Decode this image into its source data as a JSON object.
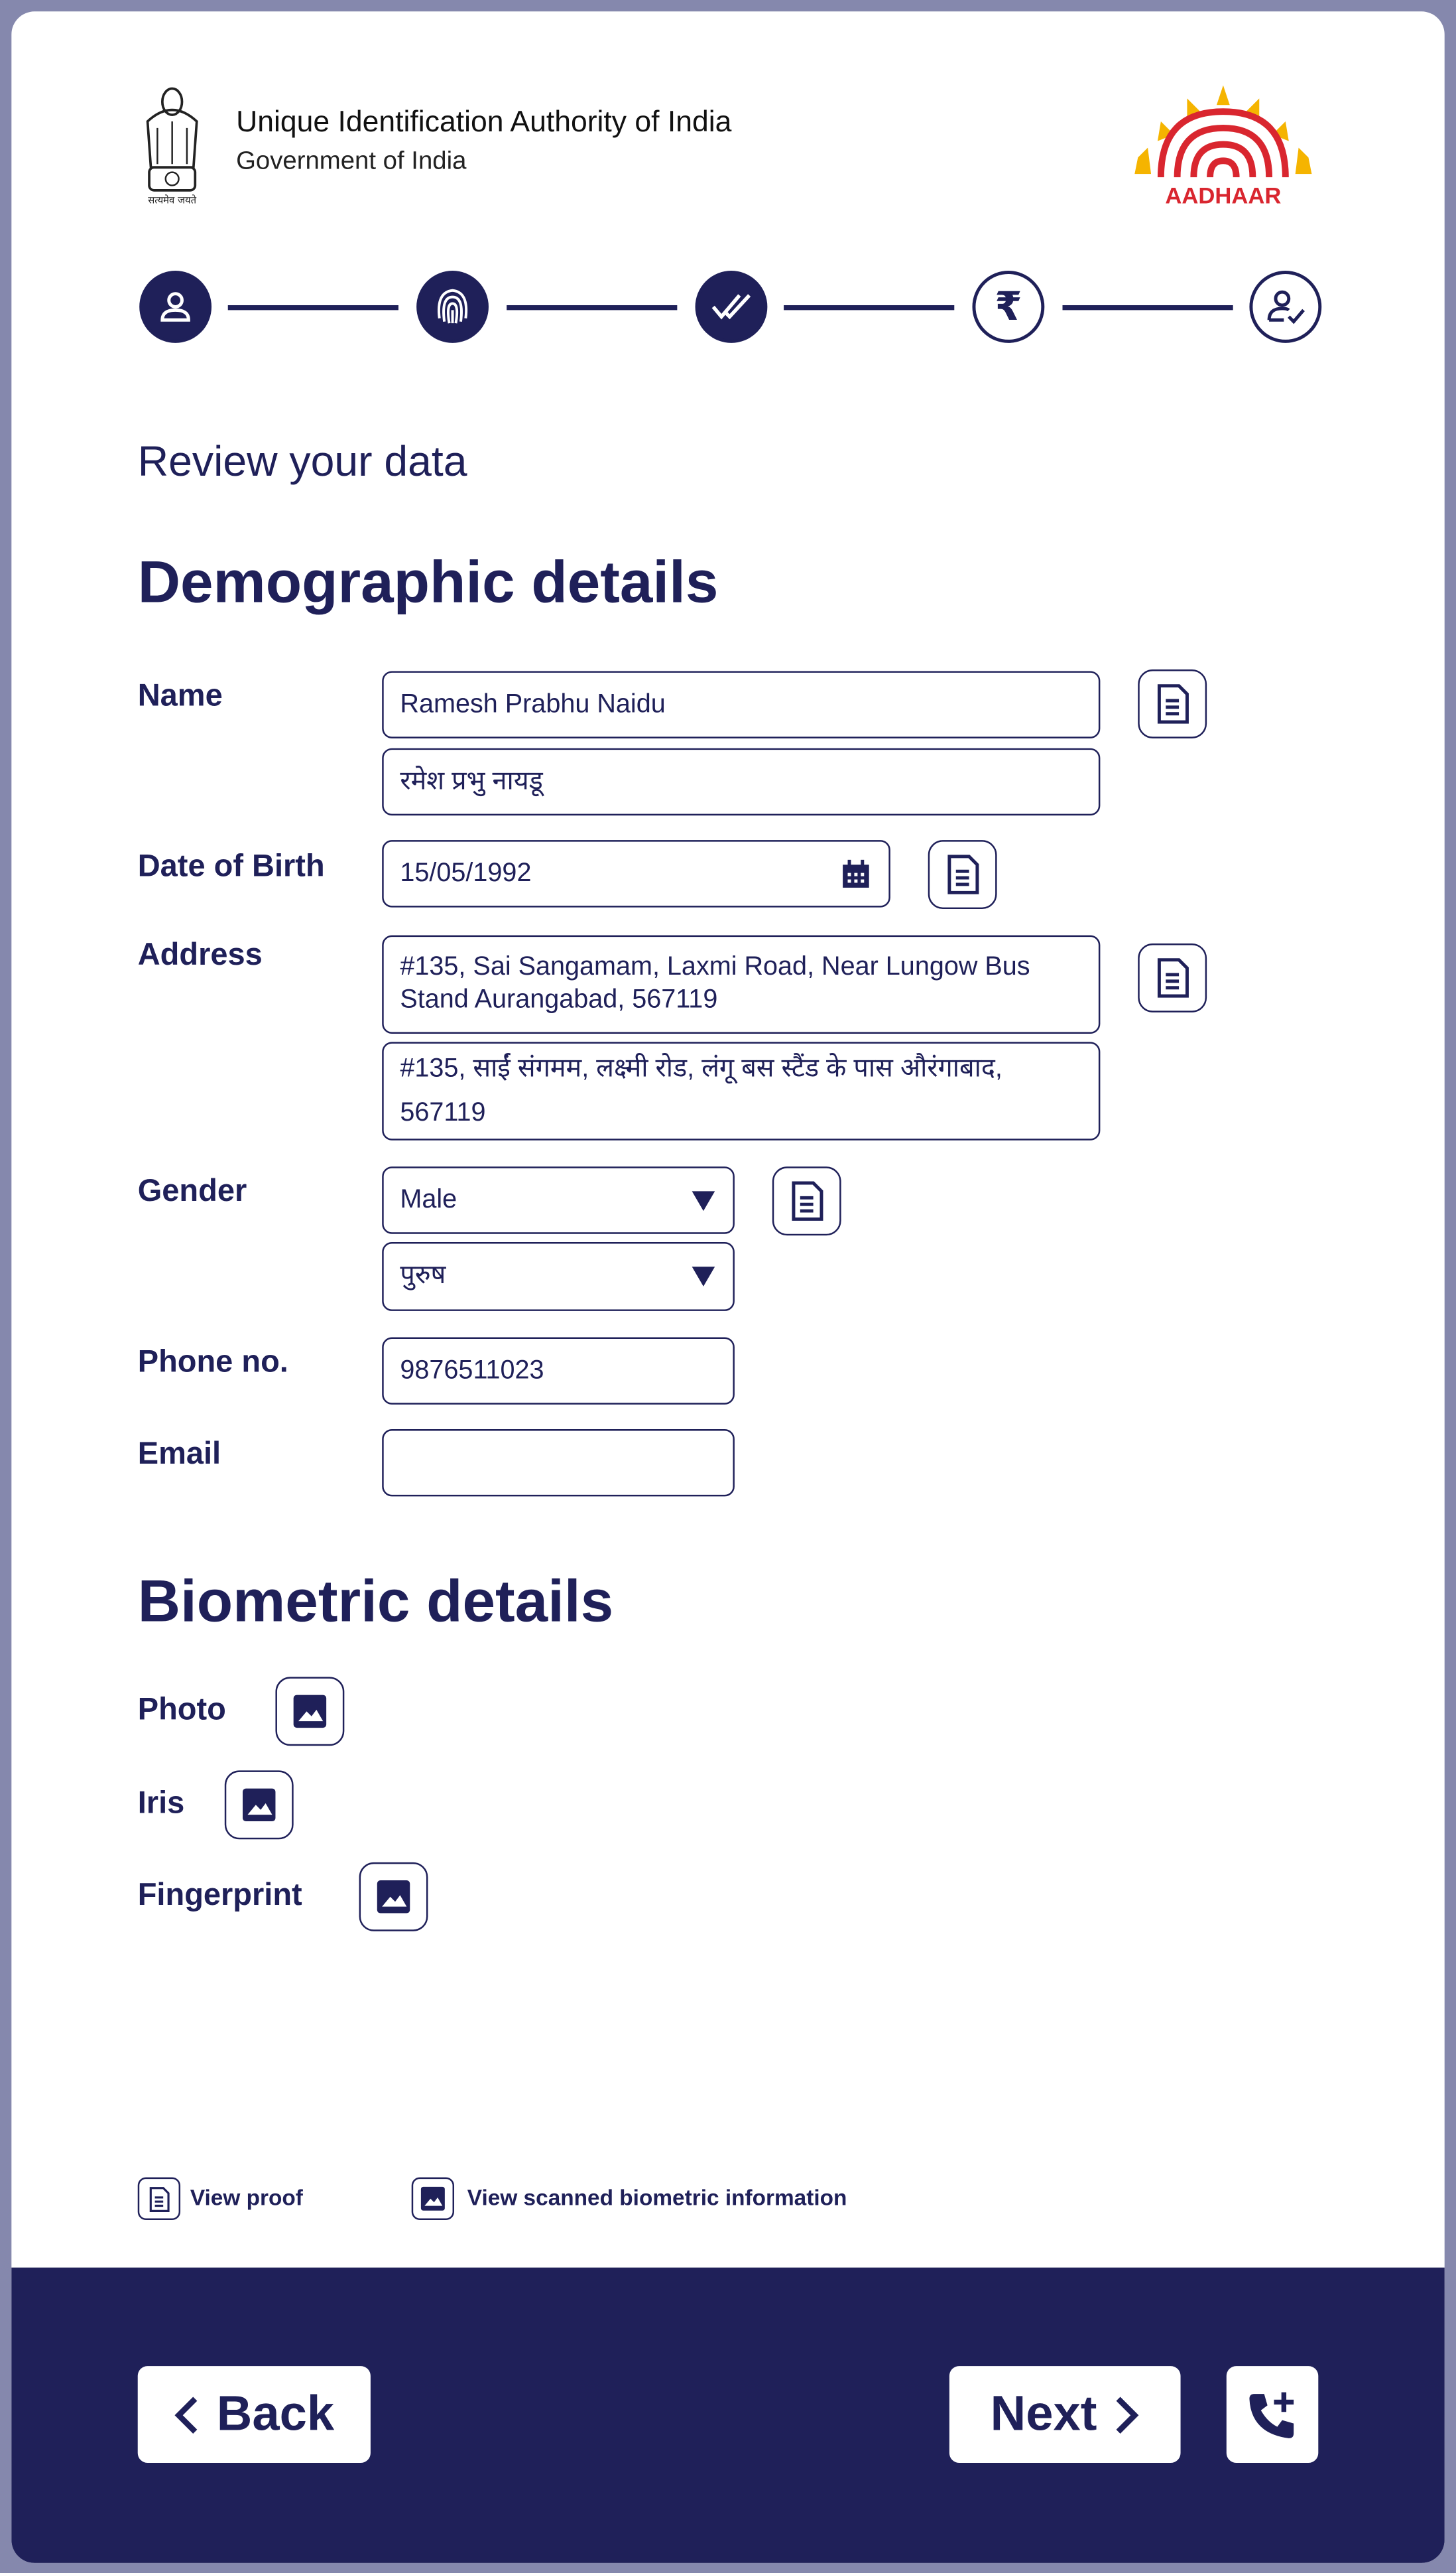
{
  "header": {
    "org_name": "Unique Identification Authority of India",
    "org_sub": "Government of India",
    "emblem_motto": "सत्यमेव जयते",
    "logo_text": "AADHAAR"
  },
  "stepper": {
    "steps": [
      {
        "icon": "user-icon",
        "status": "done"
      },
      {
        "icon": "fingerprint-icon",
        "status": "done"
      },
      {
        "icon": "double-check-icon",
        "status": "current"
      },
      {
        "icon": "rupee-icon",
        "status": "pending"
      },
      {
        "icon": "user-check-icon",
        "status": "pending"
      }
    ]
  },
  "page": {
    "subtitle": "Review your data",
    "demographic_title": "Demographic details",
    "biometric_title": "Biometric details"
  },
  "demographic": {
    "name": {
      "label": "Name",
      "value_en": "Ramesh Prabhu Naidu",
      "value_hi": "रमेश प्रभु नायडू"
    },
    "dob": {
      "label": "Date of Birth",
      "value": "15/05/1992"
    },
    "address": {
      "label": "Address",
      "value_en": "#135, Sai Sangamam, Laxmi Road, Near Lungow Bus Stand Aurangabad, 567119",
      "value_hi": "#135, साईं संगमम, लक्ष्मी रोड, लंगू बस स्टैंड के पास औरंगाबाद, 567119"
    },
    "gender": {
      "label": "Gender",
      "value_en": "Male",
      "value_hi": "पुरुष"
    },
    "phone": {
      "label": "Phone no.",
      "value": "9876511023"
    },
    "email": {
      "label": "Email",
      "value": ""
    }
  },
  "biometric": {
    "photo": "Photo",
    "iris": "Iris",
    "fingerprint": "Fingerprint"
  },
  "legend": {
    "proof": "View proof",
    "biometric": "View scanned biometric information"
  },
  "footer": {
    "back": "Back",
    "next": "Next"
  },
  "colors": {
    "primary": "#1f2059",
    "frame": "#8588ad",
    "logo_red": "#d9262f",
    "logo_yellow": "#f5b400"
  }
}
